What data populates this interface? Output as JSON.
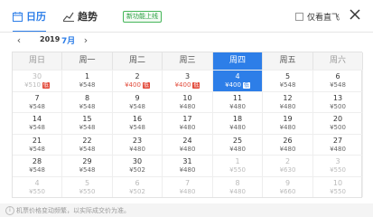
{
  "tabs": {
    "calendar": "日历",
    "trend": "趋势",
    "badge": "新功能上线"
  },
  "only_direct": "仅看直飞",
  "nav": {
    "year": "2019",
    "month": "7月"
  },
  "weekdays": [
    "周日",
    "周一",
    "周二",
    "周三",
    "周四",
    "周五",
    "周六"
  ],
  "low_tag": "低",
  "weeks": [
    [
      {
        "d": "30",
        "p": "¥510",
        "s": "past",
        "low": true
      },
      {
        "d": "1",
        "p": "¥548"
      },
      {
        "d": "2",
        "p": "¥400",
        "low": true
      },
      {
        "d": "3",
        "p": "¥400",
        "low": true
      },
      {
        "d": "4",
        "p": "¥400",
        "low": true,
        "s": "sel"
      },
      {
        "d": "5",
        "p": "¥548"
      },
      {
        "d": "6",
        "p": "¥548"
      }
    ],
    [
      {
        "d": "7",
        "p": "¥548"
      },
      {
        "d": "8",
        "p": "¥548"
      },
      {
        "d": "9",
        "p": "¥548"
      },
      {
        "d": "10",
        "p": "¥480"
      },
      {
        "d": "11",
        "p": "¥480"
      },
      {
        "d": "12",
        "p": "¥480"
      },
      {
        "d": "13",
        "p": "¥500"
      }
    ],
    [
      {
        "d": "14",
        "p": "¥548"
      },
      {
        "d": "15",
        "p": "¥548"
      },
      {
        "d": "16",
        "p": "¥548"
      },
      {
        "d": "17",
        "p": "¥480"
      },
      {
        "d": "18",
        "p": "¥480"
      },
      {
        "d": "19",
        "p": "¥480"
      },
      {
        "d": "20",
        "p": "¥500"
      }
    ],
    [
      {
        "d": "21",
        "p": "¥548"
      },
      {
        "d": "22",
        "p": "¥548"
      },
      {
        "d": "23",
        "p": "¥480"
      },
      {
        "d": "24",
        "p": "¥480"
      },
      {
        "d": "25",
        "p": "¥480"
      },
      {
        "d": "26",
        "p": "¥480"
      },
      {
        "d": "27",
        "p": "¥480"
      }
    ],
    [
      {
        "d": "28",
        "p": "¥548"
      },
      {
        "d": "29",
        "p": "¥548"
      },
      {
        "d": "30",
        "p": "¥502"
      },
      {
        "d": "31",
        "p": "¥480"
      },
      {
        "d": "1",
        "p": "¥550",
        "s": "dim"
      },
      {
        "d": "2",
        "p": "¥630",
        "s": "dim"
      },
      {
        "d": "3",
        "p": "¥550",
        "s": "dim"
      }
    ],
    [
      {
        "d": "4",
        "p": "¥550",
        "s": "dim"
      },
      {
        "d": "5",
        "p": "¥550",
        "s": "dim"
      },
      {
        "d": "6",
        "p": "¥502",
        "s": "dim"
      },
      {
        "d": "7",
        "p": "¥480",
        "s": "dim"
      },
      {
        "d": "8",
        "p": "¥480",
        "s": "dim"
      },
      {
        "d": "9",
        "p": "¥660",
        "s": "dim"
      },
      {
        "d": "10",
        "p": "¥550",
        "s": "dim"
      }
    ]
  ],
  "footer": "机票价格变动频繁，以实际成交价为准。"
}
